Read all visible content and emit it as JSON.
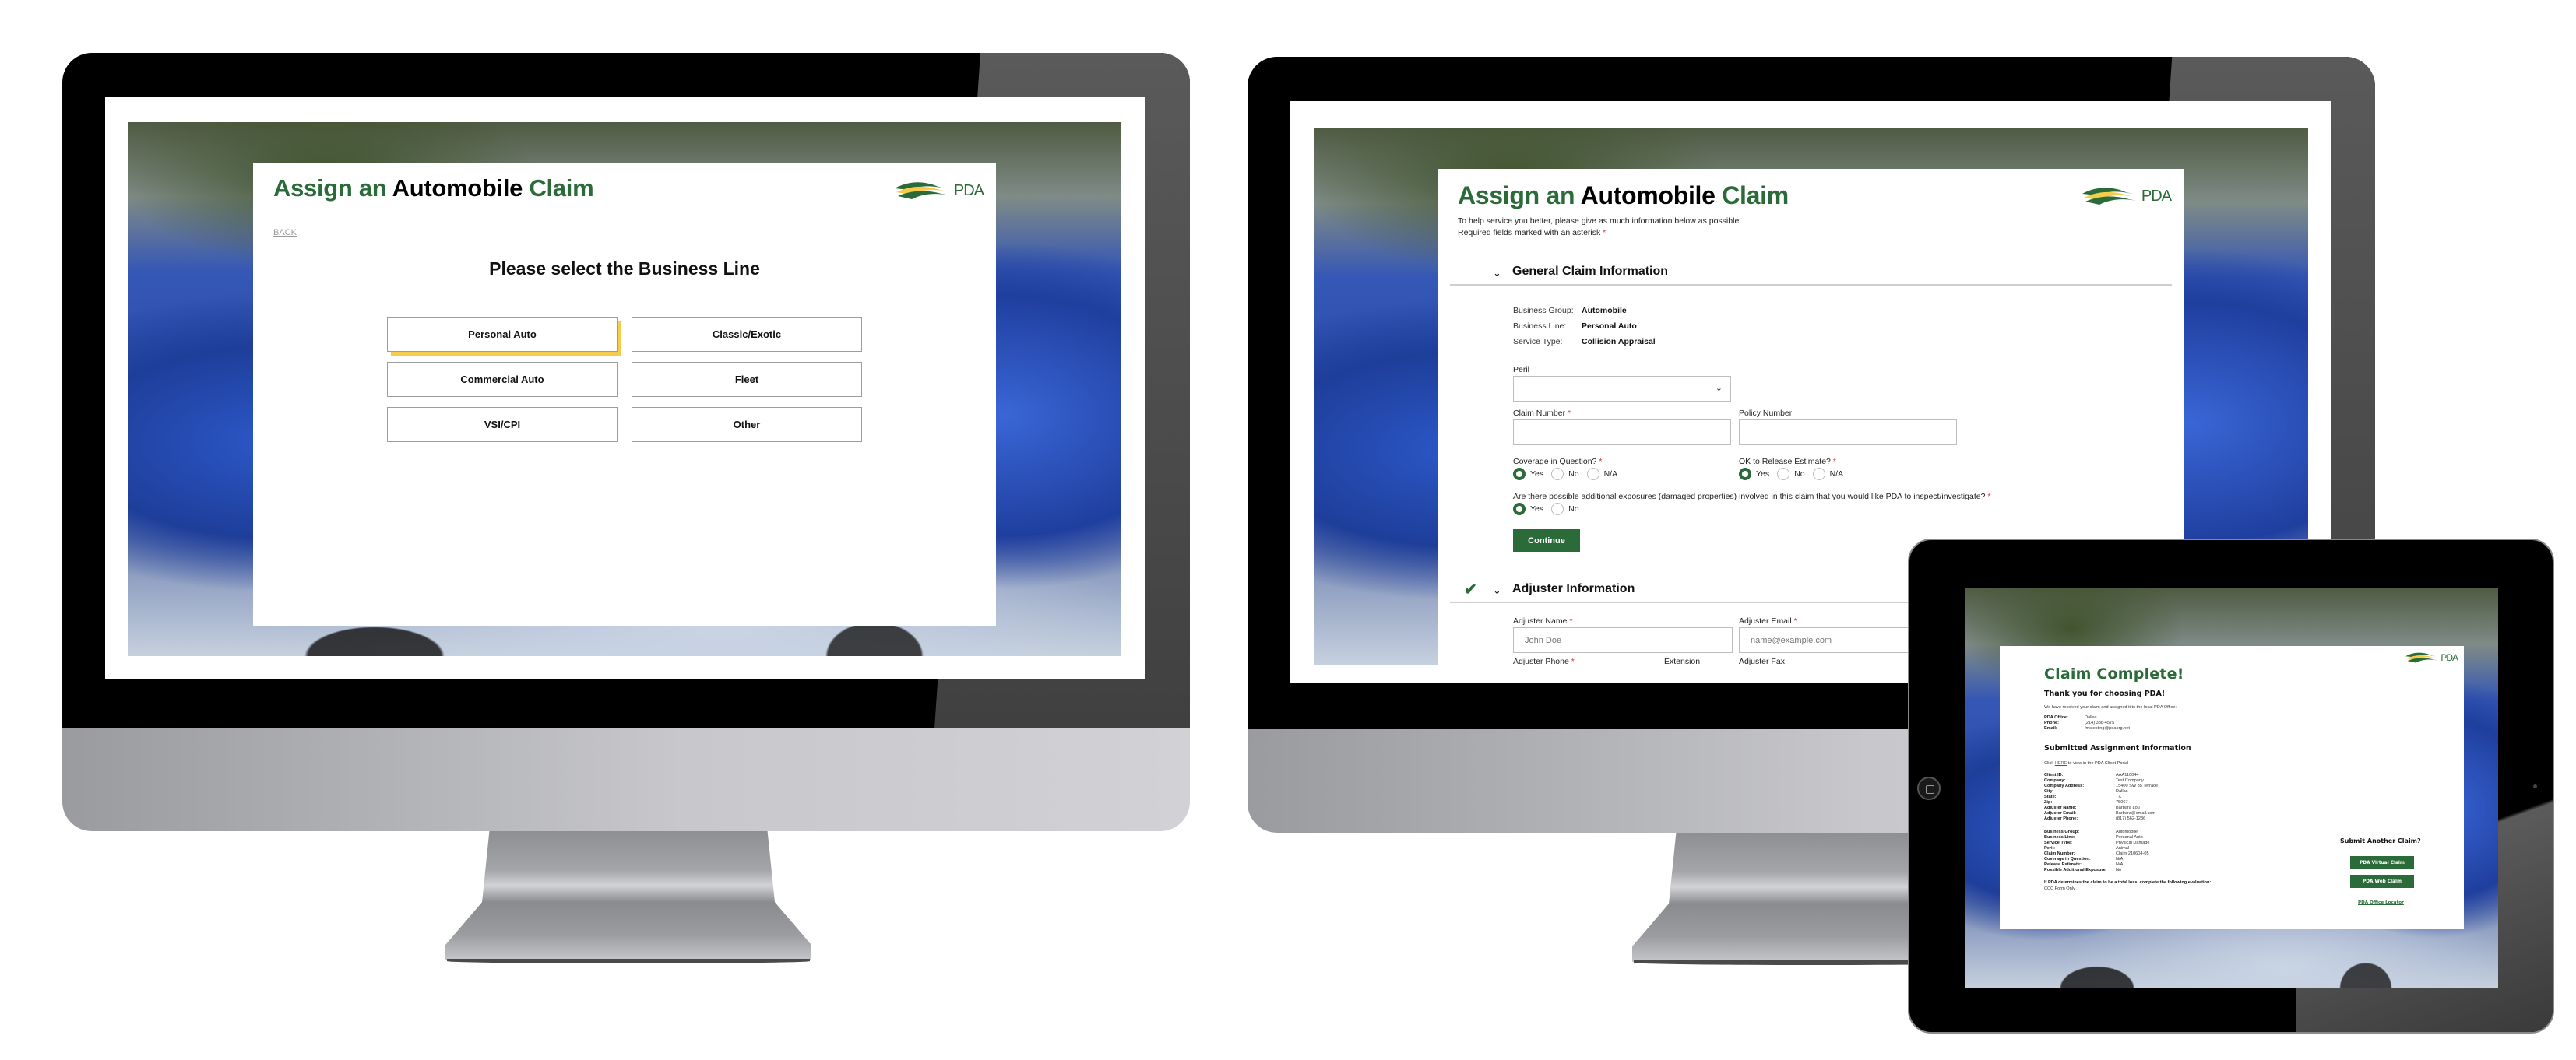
{
  "brand": {
    "logo_text": "PDA",
    "colors": {
      "green": "#2b6b3a",
      "yellow": "#f5cd4a",
      "selected_shadow": "#f5cd4a"
    }
  },
  "monitor_left": {
    "title": {
      "part1": "Assign an",
      "part2": "Automobile",
      "part3": "Claim"
    },
    "back_label": "BACK",
    "heading": "Please select the Business Line",
    "business_lines": [
      {
        "label": "Personal Auto",
        "selected": true
      },
      {
        "label": "Classic/Exotic",
        "selected": false
      },
      {
        "label": "Commercial Auto",
        "selected": false
      },
      {
        "label": "Fleet",
        "selected": false
      },
      {
        "label": "VSI/CPI",
        "selected": false
      },
      {
        "label": "Other",
        "selected": false
      }
    ]
  },
  "monitor_right": {
    "title": {
      "part1": "Assign an",
      "part2": "Automobile",
      "part3": "Claim"
    },
    "intro_line1": "To help service you better, please give as much information below as possible.",
    "intro_line2": "Required fields marked with an asterisk",
    "required_mark": "*",
    "general_section": {
      "title": "General Claim Information",
      "chevron_icon": "chevron-down-icon",
      "summary": [
        {
          "label": "Business Group:",
          "value": "Automobile"
        },
        {
          "label": "Business Line:",
          "value": "Personal Auto"
        },
        {
          "label": "Service Type:",
          "value": "Collision Appraisal"
        }
      ],
      "peril": {
        "label": "Peril",
        "value": ""
      },
      "claim_number": {
        "label": "Claim Number",
        "required": true,
        "value": ""
      },
      "policy_number": {
        "label": "Policy Number",
        "required": false,
        "value": ""
      },
      "coverage_in_question": {
        "label": "Coverage in Question?",
        "options": [
          "Yes",
          "No",
          "N/A"
        ],
        "selected": "Yes"
      },
      "ok_to_release": {
        "label": "OK to Release Estimate?",
        "options": [
          "Yes",
          "No",
          "N/A"
        ],
        "selected": "Yes"
      },
      "additional_exposures": {
        "label": "Are there possible additional exposures (damaged properties) involved in this claim that you would like PDA to inspect/investigate?",
        "options": [
          "Yes",
          "No"
        ],
        "selected": "Yes"
      },
      "continue_label": "Continue"
    },
    "adjuster_section": {
      "title": "Adjuster Information",
      "completed": true,
      "adjuster_name": {
        "label": "Adjuster Name",
        "placeholder": "John Doe"
      },
      "adjuster_email": {
        "label": "Adjuster Email",
        "placeholder": "name@example.com"
      },
      "adjuster_phone": {
        "label": "Adjuster Phone"
      },
      "extension": {
        "label": "Extension"
      },
      "adjuster_fax": {
        "label": "Adjuster Fax"
      }
    }
  },
  "tablet": {
    "title": "Claim Complete!",
    "thank_you": "Thank you for choosing PDA!",
    "received_text": "We have received your claim and assigned it to the local PDA Office:",
    "office": [
      {
        "label": "PDA Office:",
        "value": "Dallas"
      },
      {
        "label": "Phone:",
        "value": "(214) 388-4575"
      },
      {
        "label": "Email:",
        "value": "fmstesting@pdaorg.net"
      }
    ],
    "submitted_heading": "Submitted Assignment Information",
    "portal_pre": "Click",
    "portal_link": "HERE",
    "portal_post": "to view in the PDA Client Portal",
    "client_info": [
      {
        "label": "Client ID:",
        "value": "AAA110044"
      },
      {
        "label": "Company:",
        "value": "Test Company"
      },
      {
        "label": "Company Address:",
        "value": "15400 SW 35 Terrace"
      },
      {
        "label": "City:",
        "value": "Dallas"
      },
      {
        "label": "State:",
        "value": "TX"
      },
      {
        "label": "Zip:",
        "value": "75067"
      },
      {
        "label": "Adjuster Name:",
        "value": "Barbara Lou"
      },
      {
        "label": "Adjuster Email:",
        "value": "Barbara@email.com"
      },
      {
        "label": "Adjuster Phone:",
        "value": "(817) 562-1236"
      }
    ],
    "claim_info": [
      {
        "label": "Business Group:",
        "value": "Automobile"
      },
      {
        "label": "Business Line:",
        "value": "Personal Auto"
      },
      {
        "label": "Service Type:",
        "value": "Physical Damage"
      },
      {
        "label": "Peril:",
        "value": "Animal"
      },
      {
        "label": "Claim Number:",
        "value": "Claim 210604-05"
      },
      {
        "label": "Coverage in Question:",
        "value": "N/A"
      },
      {
        "label": "Release Estimate:",
        "value": "N/A"
      },
      {
        "label": "Possible Additional Exposure:",
        "value": "No"
      }
    ],
    "total_loss_text": "If PDA determines the claim to be a total loss, complete the following evaluation:",
    "total_loss_value": "CCC Form Only",
    "submit_another": "Submit Another Claim?",
    "virtual_claim_label": "PDA Virtual Claim",
    "web_claim_label": "PDA Web Claim",
    "office_locator_label": "PDA Office Locator"
  }
}
